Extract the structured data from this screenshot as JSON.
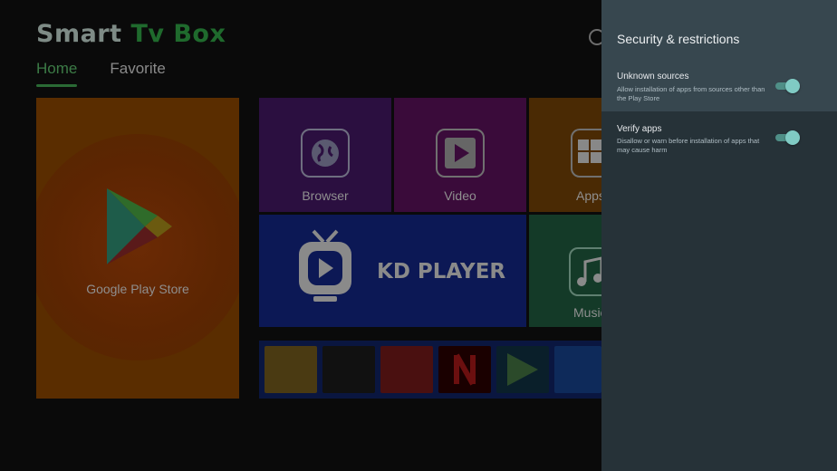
{
  "launcher": {
    "brand_part1": "Smart",
    "brand_part2": "Tv Box",
    "nav": [
      {
        "label": "Home",
        "active": true
      },
      {
        "label": "Favorite",
        "active": false
      }
    ],
    "tiles": {
      "play_store": "Google Play Store",
      "browser": "Browser",
      "video": "Video",
      "apps": "Apps",
      "kd_player": "KD PLAYER",
      "music": "Music"
    },
    "mini_apps": [
      {
        "name": "cinema-app-icon",
        "color": "#5a4a10"
      },
      {
        "name": "iptv-app-icon",
        "color": "#111111"
      },
      {
        "name": "home-app-icon",
        "color": "#5a1010"
      },
      {
        "name": "netflix-app-icon",
        "color": "#1a0000"
      },
      {
        "name": "play-app-icon",
        "color": "#0f2a20"
      },
      {
        "name": "tv-app-icon",
        "color": "#0e2a5a"
      }
    ]
  },
  "panel": {
    "title": "Security & restrictions",
    "items": [
      {
        "title": "Unknown sources",
        "description": "Allow installation of apps from sources other than the Play Store",
        "enabled": true,
        "focused": true
      },
      {
        "title": "Verify apps",
        "description": "Disallow or warn before installation of apps that may cause harm",
        "enabled": true,
        "focused": false
      }
    ]
  },
  "colors": {
    "panel_bg": "#263238",
    "panel_header_bg": "#37474f",
    "toggle_accent": "#80cbc4"
  }
}
